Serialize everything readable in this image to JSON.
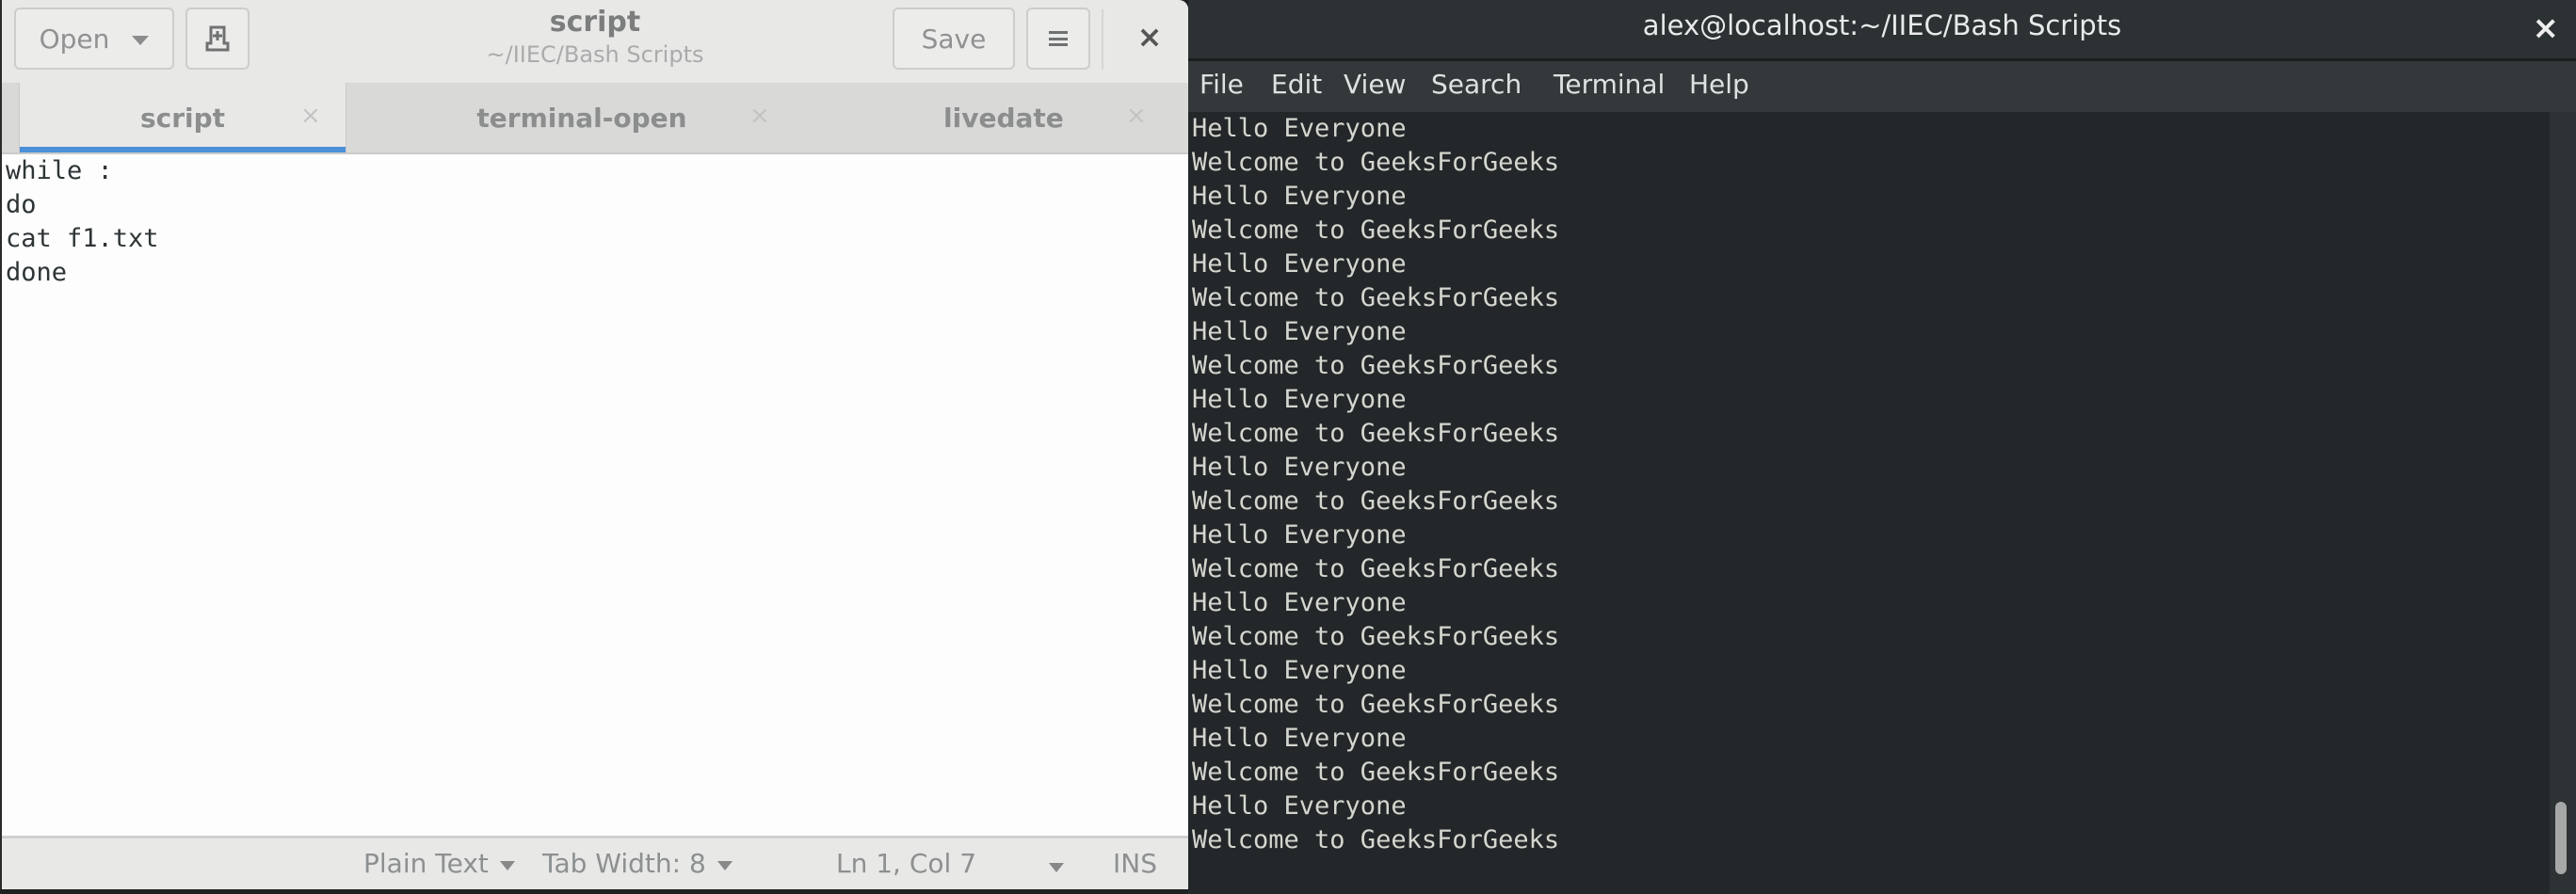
{
  "editor": {
    "title": "script",
    "subtitle": "~/IIEC/Bash Scripts",
    "open_label": "Open",
    "save_label": "Save",
    "close_glyph": "×",
    "tabs": [
      {
        "label": "script",
        "active": true,
        "close_glyph": "×"
      },
      {
        "label": "terminal-open",
        "active": false,
        "close_glyph": "×"
      },
      {
        "label": "livedate",
        "active": false,
        "close_glyph": "×"
      }
    ],
    "code_lines": [
      "while :",
      "do",
      "cat f1.txt",
      "done"
    ],
    "status": {
      "language": "Plain Text",
      "tab_width": "Tab Width: 8",
      "position": "Ln 1, Col 7",
      "mode": "INS"
    },
    "accent_color": "#4a90d9"
  },
  "terminal": {
    "title": "alex@localhost:~/IIEC/Bash Scripts",
    "close_glyph": "×",
    "menu": [
      "File",
      "Edit",
      "View",
      "Search",
      "Terminal",
      "Help"
    ],
    "lines": [
      "Hello Everyone",
      "Welcome to GeeksForGeeks",
      "Hello Everyone",
      "Welcome to GeeksForGeeks",
      "Hello Everyone",
      "Welcome to GeeksForGeeks",
      "Hello Everyone",
      "Welcome to GeeksForGeeks",
      "Hello Everyone",
      "Welcome to GeeksForGeeks",
      "Hello Everyone",
      "Welcome to GeeksForGeeks",
      "Hello Everyone",
      "Welcome to GeeksForGeeks",
      "Hello Everyone",
      "Welcome to GeeksForGeeks",
      "Hello Everyone",
      "Welcome to GeeksForGeeks",
      "Hello Everyone",
      "Welcome to GeeksForGeeks",
      "Hello Everyone",
      "Welcome to GeeksForGeeks"
    ],
    "scroll_position": 0.98,
    "scroll_visible_fraction": 0.1
  }
}
